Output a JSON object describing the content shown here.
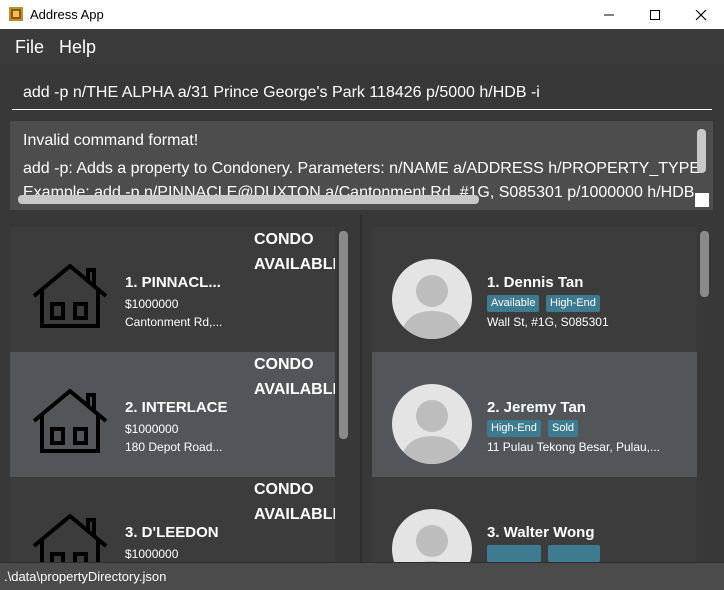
{
  "window": {
    "title": "Address App"
  },
  "menu": {
    "file": "File",
    "help": "Help"
  },
  "command": {
    "value": "add -p n/THE ALPHA a/31 Prince George's Park 118426 p/5000 h/HDB -i"
  },
  "result": {
    "line1": "Invalid command format!",
    "line2": "add -p: Adds a property to Condonery. Parameters: n/NAME a/ADDRESS h/PROPERTY_TYPE",
    "line3": "Example: add -p n/PINNACLE@DUXTON a/Cantonment Rd, #1G, S085301 p/1000000 h/HDB"
  },
  "properties": [
    {
      "index_name": "1.  PINNACL...",
      "price": "$1000000",
      "address": "Cantonment Rd,...",
      "type": "CONDO",
      "status": "AVAILABLE"
    },
    {
      "index_name": "2.  INTERLACE",
      "price": "$1000000",
      "address": "180 Depot Road...",
      "type": "CONDO",
      "status": "AVAILABLE"
    },
    {
      "index_name": "3.  D'LEEDON",
      "price": "$1000000",
      "address": "",
      "type": "CONDO",
      "status": "AVAILABLE"
    }
  ],
  "clients": [
    {
      "index_name": "1.  Dennis Tan",
      "tags": [
        "Available",
        "High-End"
      ],
      "address": "Wall St, #1G, S085301"
    },
    {
      "index_name": "2.  Jeremy Tan",
      "tags": [
        "High-End",
        "Sold"
      ],
      "address": "11 Pulau Tekong Besar, Pulau,..."
    },
    {
      "index_name": "3.  Walter Wong",
      "tags": [
        "",
        ""
      ],
      "address": ""
    }
  ],
  "status": {
    "path": ".\\data\\propertyDirectory.json"
  },
  "colors": {
    "background": "#383838",
    "card_alt": "#525659",
    "tag": "#3e7b91"
  }
}
